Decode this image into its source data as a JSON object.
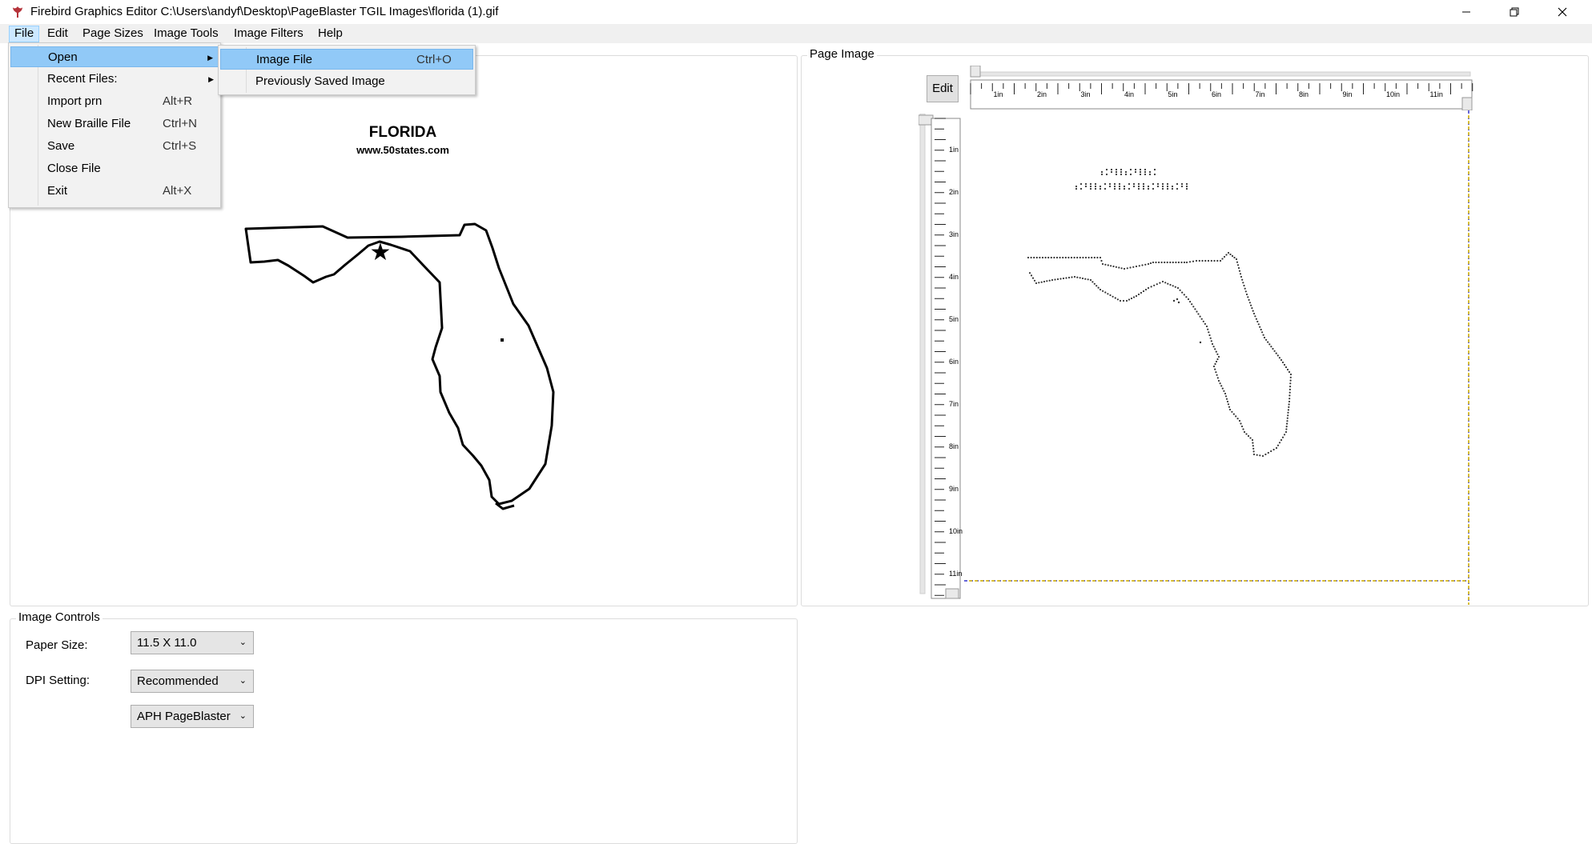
{
  "window": {
    "title": "Firebird Graphics Editor C:\\Users\\andyf\\Desktop\\PageBlaster TGIL Images\\florida (1).gif",
    "icon": "firebird-icon",
    "controls": [
      "minimize-icon",
      "restore-icon",
      "close-icon"
    ]
  },
  "menubar": {
    "file": "File",
    "edit": "Edit",
    "page_sizes": "Page Sizes",
    "image_tools": "Image Tools",
    "image_filters": "Image Filters",
    "help": "Help"
  },
  "file_menu": {
    "items": [
      {
        "label": "Open",
        "shortcut": "",
        "submenu": true,
        "highlighted": true
      },
      {
        "label": "Recent Files:",
        "shortcut": "",
        "submenu": true
      },
      {
        "label": "Import prn",
        "shortcut": "Alt+R"
      },
      {
        "label": "New Braille File",
        "shortcut": "Ctrl+N"
      },
      {
        "label": "Save",
        "shortcut": "Ctrl+S"
      },
      {
        "label": "Close File",
        "shortcut": ""
      },
      {
        "label": "Exit",
        "shortcut": "Alt+X"
      }
    ]
  },
  "open_submenu": {
    "items": [
      {
        "label": "Image File",
        "shortcut": "Ctrl+O",
        "highlighted": true
      },
      {
        "label": "Previously Saved Image",
        "shortcut": ""
      }
    ]
  },
  "original_panel": {
    "image_title": "FLORIDA",
    "image_subtitle": "www.50states.com"
  },
  "page_panel": {
    "title": "Page Image",
    "edit_label": "Edit",
    "ruler_labels": [
      "1in",
      "2in",
      "3in",
      "4in",
      "5in",
      "6in",
      "7in",
      "8in",
      "9in",
      "10in",
      "11in"
    ]
  },
  "controls": {
    "title": "Image Controls",
    "paper_size_label": "Paper Size:",
    "paper_size_value": "11.5 X 11.0",
    "dpi_label": "DPI Setting:",
    "dpi_value": "Recommended",
    "device_value": "APH PageBlaster"
  },
  "colors": {
    "menubar_bg": "#f0f0f0",
    "menu_highlight": "#91c9f7",
    "file_menu_active": "#cce8ff",
    "page_border_dashed": "#3333cc",
    "page_border_dashed_alt": "#e6c200"
  }
}
